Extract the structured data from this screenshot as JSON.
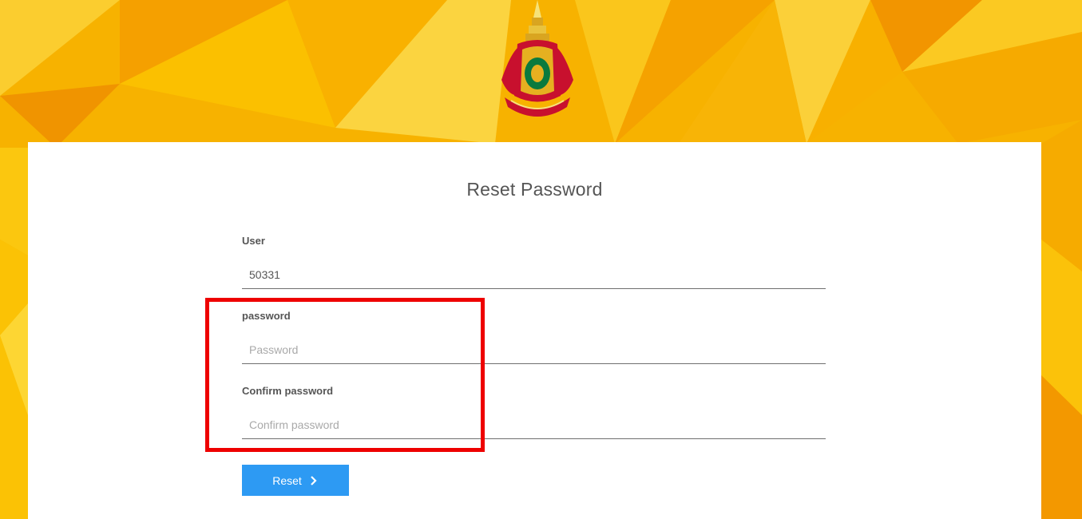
{
  "page": {
    "background_colors": [
      "#f9c20d",
      "#f5a300",
      "#fbd34a",
      "#f29200"
    ]
  },
  "header": {
    "emblem_icon": "royal-emblem-icon"
  },
  "form": {
    "title": "Reset Password",
    "user": {
      "label": "User",
      "value": "50331"
    },
    "password": {
      "label": "password",
      "placeholder": "Password"
    },
    "confirm": {
      "label": "Confirm password",
      "placeholder": "Confirm password"
    },
    "reset_button": {
      "label": "Reset",
      "icon": "chevron-right-icon",
      "color": "#2d9af3"
    }
  },
  "annotation": {
    "highlight_color": "#ee0000"
  }
}
